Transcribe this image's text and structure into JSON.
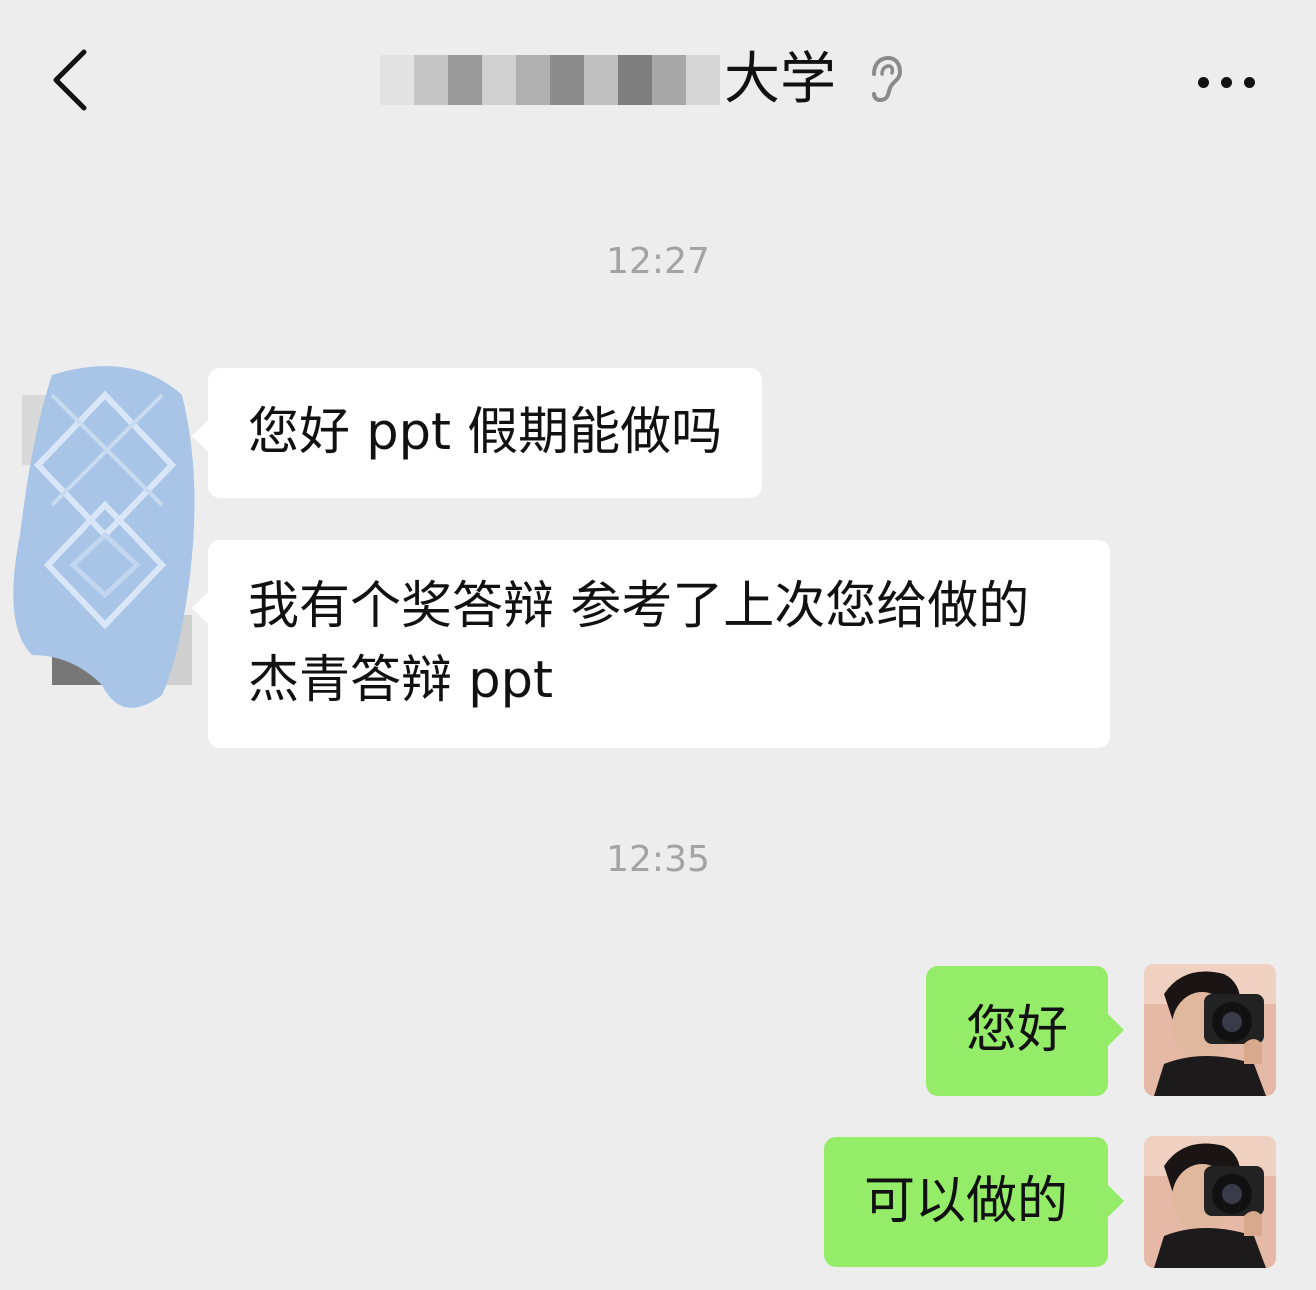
{
  "header": {
    "title_visible": "大学",
    "back_icon": "chevron-left-icon",
    "ear_icon": "ear-icon",
    "more_icon": "more-dots-icon"
  },
  "messages": {
    "time_1": "12:27",
    "incoming": [
      {
        "text": "您好 ppt 假期能做吗"
      },
      {
        "text": "我有个奖答辩 参考了上次您给做的杰青答辩 ppt"
      }
    ],
    "time_2": "12:35",
    "outgoing": [
      {
        "text": "您好"
      },
      {
        "text": "可以做的"
      }
    ]
  },
  "colors": {
    "background": "#ededed",
    "incoming_bubble": "#ffffff",
    "outgoing_bubble": "#95ec69",
    "timestamp_text": "#a3a3a3"
  }
}
